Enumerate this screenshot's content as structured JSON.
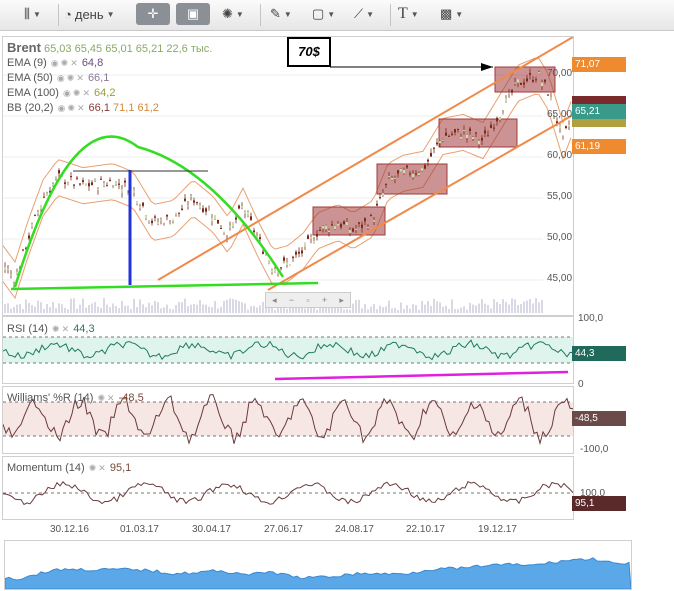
{
  "toolbar": {
    "period_label": "день"
  },
  "main": {
    "symbol": "Brent",
    "ohlc": [
      "65,03",
      "65,45",
      "65,01",
      "65,21"
    ],
    "volume": "22,6 тыс.",
    "indicators": [
      {
        "name": "EMA (9)",
        "value": "64,8"
      },
      {
        "name": "EMA (50)",
        "value": "66,1"
      },
      {
        "name": "EMA (100)",
        "value": "64,2"
      },
      {
        "name": "BB (20,2)",
        "values": [
          "66,1",
          "71,1",
          "61,2"
        ]
      }
    ],
    "y_ticks": [
      "70,00",
      "65,00",
      "60,00",
      "55,00",
      "50,00",
      "45,00"
    ],
    "price_tags": [
      "71,07",
      "65,21",
      "61,19"
    ],
    "annotation": "70$"
  },
  "rsi": {
    "name": "RSI (14)",
    "value": "44,3",
    "ticks": [
      "100,0",
      "0"
    ],
    "tag": "44,3"
  },
  "williams": {
    "name": "Williams' %R (14)",
    "value": "-48,5",
    "ticks": [
      "-100,0"
    ],
    "tag": "-48,5"
  },
  "momentum": {
    "name": "Momentum (14)",
    "value": "95,1",
    "ticks": [
      "100,0"
    ],
    "tag": "95,1"
  },
  "x_axis": [
    "30.12.16",
    "01.03.17",
    "30.04.17",
    "27.06.17",
    "24.08.17",
    "22.10.17",
    "19.12.17"
  ],
  "colors": {
    "candle": "#7a2a1a",
    "bands": "#e8a070",
    "channel": "#f08a4a",
    "pattern": "#33dd22",
    "rsi_line": "#1f7a5a",
    "rsi_support": "#e020e0",
    "tag_orange": "#f08a2e",
    "tag_green": "#2a8a6a",
    "tag_brown": "#6b4040",
    "box": "#a03a3a"
  }
}
